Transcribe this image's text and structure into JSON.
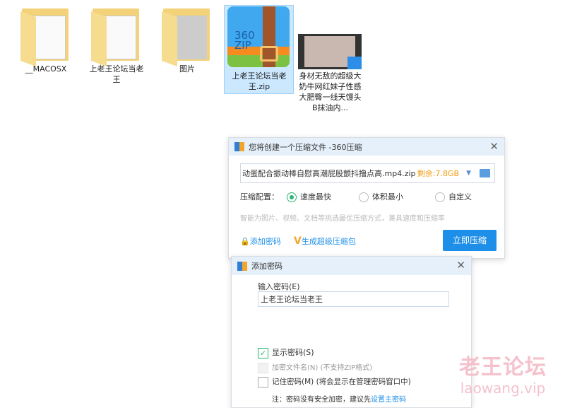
{
  "files": [
    {
      "name": "__MACOSX",
      "icon": "folder-icon"
    },
    {
      "name": "上老王论坛当老王",
      "icon": "folder-icon"
    },
    {
      "name": "图片",
      "icon": "folder-icon"
    },
    {
      "name": "上老王论坛当老王.zip",
      "icon": "zip-icon",
      "zip_text1": "360",
      "zip_text2": "ZIP"
    },
    {
      "name": "身材无敌的超级大奶牛网红妹子性感大肥臀一线天馒头B抹油内...",
      "icon": "video-icon"
    }
  ],
  "compress_dialog": {
    "title": "您将创建一个压缩文件 -360压缩",
    "filename": "动蛋配合振动棒自慰高潮屁股颤抖撸点高.mp4.zip",
    "free_space": "剩余:7.8GB",
    "config_label": "压缩配置：",
    "options": [
      "速度最快",
      "体积最小",
      "自定义"
    ],
    "hint": "智能为图片、视频、文档等挑选最优压缩方式，兼具速度和压缩率",
    "add_password": "添加密码",
    "super_pack": "生成超级压缩包",
    "compress_button": "立即压缩",
    "colors": {
      "accent": "#1e8fe8",
      "orange": "#f39c12"
    }
  },
  "password_dialog": {
    "title": "添加密码",
    "input_label": "输入密码(E)",
    "password": "上老王论坛当老王",
    "show_password": "显示密码(S)",
    "encrypt_names": "加密文件名(N) (不支持ZIP格式)",
    "remember": "记住密码(M) (将会显示在管理密码窗口中)",
    "note": "注：密码没有安全加密，建议先",
    "note_link": "设置主密码"
  },
  "watermark": {
    "line1": "老王论坛",
    "line2": "laowang.vip"
  }
}
